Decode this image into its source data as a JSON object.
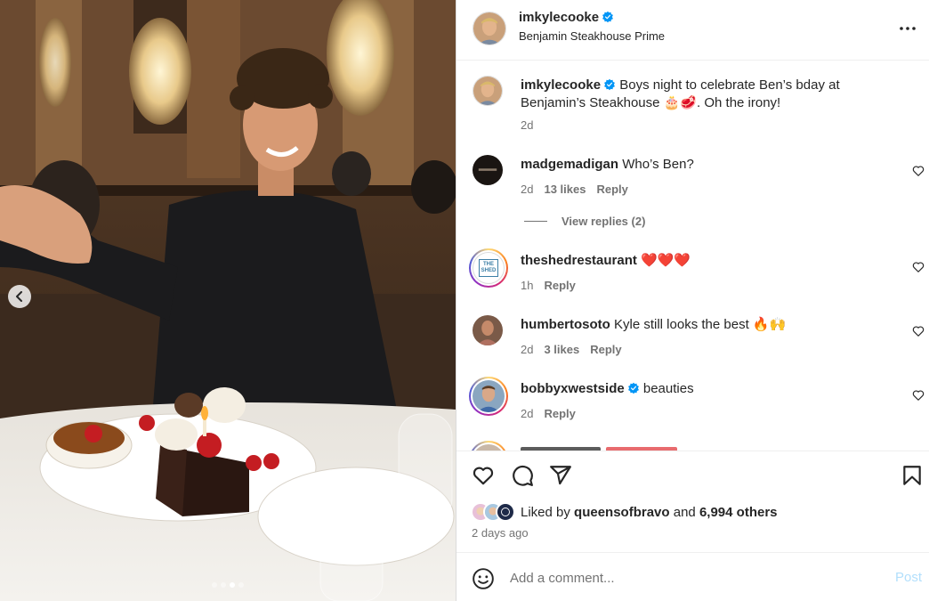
{
  "header": {
    "username": "imkylecooke",
    "location": "Benjamin Steakhouse Prime"
  },
  "caption": {
    "username": "imkylecooke",
    "text": "Boys night to celebrate Ben’s bday at Benjamin’s Steakhouse 🎂🥩. Oh the irony!",
    "age": "2d"
  },
  "comments": [
    {
      "username": "madgemadigan",
      "text": "Who’s Ben?",
      "age": "2d",
      "likes": "13 likes",
      "reply_label": "Reply"
    },
    {
      "username": "theshedrestaurant",
      "text": "❤️❤️❤️",
      "age": "1h",
      "likes": "",
      "reply_label": "Reply",
      "avatar_text": "THE SHED"
    },
    {
      "username": "humbertosoto",
      "text": "Kyle still looks the best 🔥🙌",
      "age": "2d",
      "likes": "3 likes",
      "reply_label": "Reply"
    },
    {
      "username": "bobbyxwestside",
      "text": "beauties",
      "age": "2d",
      "likes": "",
      "reply_label": "Reply"
    }
  ],
  "view_replies": "View replies (2)",
  "likes": {
    "prefix": "Liked by",
    "user": "queensofbravo",
    "middle": "and",
    "others": "6,994 others"
  },
  "post_date": "2 days ago",
  "comment_input": {
    "placeholder": "Add a comment...",
    "post_label": "Post"
  },
  "icons": [
    "more-icon",
    "heart-icon",
    "comment-icon",
    "share-icon",
    "bookmark-icon",
    "emoji-icon",
    "verified-icon",
    "chevron-left-icon"
  ],
  "colors": {
    "verified": "#0095f6",
    "post_button_disabled": "#b2dffc",
    "secondary_text": "#737373"
  },
  "carousel": {
    "total": 4,
    "active": 3
  }
}
